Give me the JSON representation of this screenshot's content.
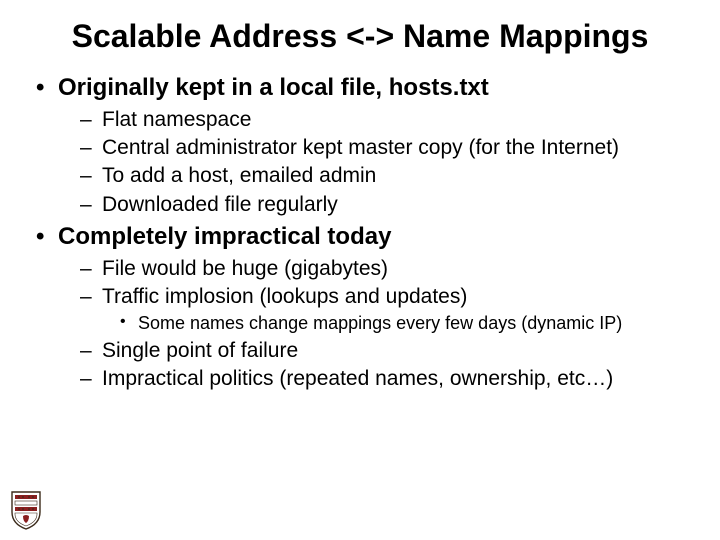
{
  "title": "Scalable Address <-> Name Mappings",
  "bullets": {
    "b1": "Originally kept in a local file, hosts.txt",
    "b1_1": "Flat namespace",
    "b1_2": "Central administrator kept master copy (for the Internet)",
    "b1_3": "To add a host, emailed admin",
    "b1_4": "Downloaded file regularly",
    "b2": "Completely impractical today",
    "b2_1": "File would be huge (gigabytes)",
    "b2_2": "Traffic implosion (lookups and updates)",
    "b2_2_1": "Some names change mappings every few days (dynamic IP)",
    "b2_3": "Single point of failure",
    "b2_4": "Impractical politics (repeated names, ownership, etc…)"
  },
  "logo": {
    "name": "brown-university-shield",
    "colors": {
      "red": "#8a1f1f",
      "dark": "#3b2a1a",
      "white": "#ffffff",
      "gray": "#666666"
    }
  }
}
